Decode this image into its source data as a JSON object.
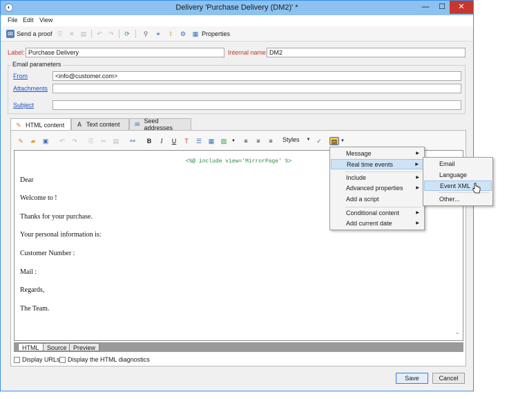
{
  "window": {
    "title": "Delivery 'Purchase Delivery (DM2)' *",
    "minimize": "—",
    "maximize": "☐",
    "close": "✕"
  },
  "menubar": [
    "File",
    "Edit",
    "View"
  ],
  "toolbar": {
    "send_proof": "Send a proof",
    "properties": "Properties"
  },
  "form": {
    "label_caption": "Label:",
    "label_value": "Purchase Delivery",
    "internal_name_caption": "Internal name:",
    "internal_name_value": "DM2",
    "email_params_title": "Email parameters",
    "from_link": "From",
    "from_value": "<info@customer.com>",
    "attachments_link": "Attachments",
    "attachments_value": "",
    "subject_link": "Subject",
    "subject_value": ""
  },
  "tabs": [
    {
      "label": "HTML content",
      "active": true
    },
    {
      "label": "Text content",
      "active": false
    },
    {
      "label": "Seed addresses",
      "active": false
    }
  ],
  "editor_toolbar": {
    "styles_label": "Styles"
  },
  "editor": {
    "include_line": "<%@ include view='MirrorPage' %>",
    "lines": [
      "Dear",
      "Welcome to !",
      "Thanks for your purchase.",
      "Your personal information is:",
      "Customer Number :",
      "Mail :",
      "Regards,",
      "The  Team."
    ]
  },
  "bottom_tabs": [
    "HTML",
    "Source",
    "Preview"
  ],
  "checkboxes": {
    "display_urls": "Display URLs",
    "html_diagnostics": "Display the HTML diagnostics"
  },
  "buttons": {
    "save": "Save",
    "cancel": "Cancel"
  },
  "context_menu": {
    "items": [
      {
        "label": "Message",
        "submenu": true
      },
      {
        "label": "Real time events",
        "submenu": true,
        "highlighted": true
      },
      {
        "label": "Include",
        "submenu": true
      },
      {
        "label": "Advanced properties",
        "submenu": true
      },
      {
        "label": "Add a script",
        "submenu": false
      },
      {
        "label": "Conditional content",
        "submenu": true
      },
      {
        "label": "Add current date",
        "submenu": true
      }
    ]
  },
  "submenu": {
    "items": [
      {
        "label": "Email",
        "highlighted": false
      },
      {
        "label": "Language",
        "highlighted": false
      },
      {
        "label": "Event XML",
        "highlighted": true
      },
      {
        "label": "Other...",
        "highlighted": false
      }
    ]
  },
  "colors": {
    "titlebar": "#8cc1f0",
    "required_label": "#c0392b",
    "link": "#1a4fcf",
    "include_text": "#2e8b3e",
    "highlight": "#cfe3f7"
  }
}
